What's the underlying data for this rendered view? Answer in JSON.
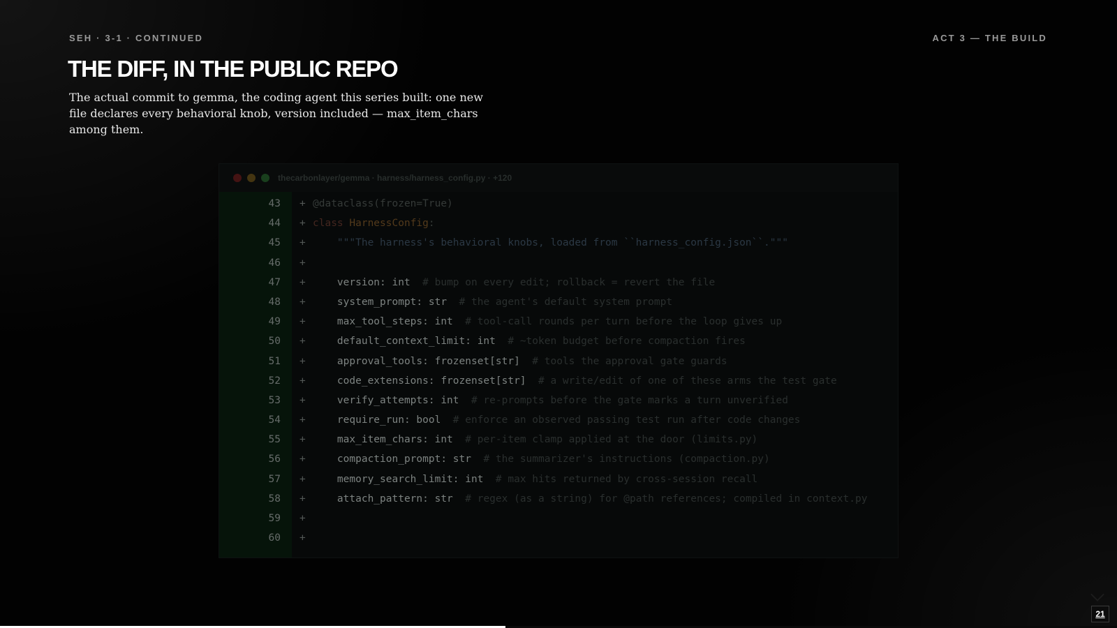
{
  "header": {
    "section_label": "SEH · 3-1 · CONTINUED",
    "act_label": "ACT 3 — THE BUILD"
  },
  "slide": {
    "title": "THE DIFF, IN THE PUBLIC REPO",
    "subtitle": "The actual commit to gemma, the coding agent this series built: one new file declares every behavioral knob, version included — max_item_chars among them."
  },
  "code_window": {
    "title": "thecarbonlayer/gemma · harness/harness_config.py · +120",
    "controls": [
      "close",
      "minimize",
      "maximize"
    ],
    "lines": [
      {
        "n": "43",
        "sign": "+",
        "parts": [
          {
            "c": "deco",
            "t": "@dataclass(frozen=True)"
          }
        ]
      },
      {
        "n": "44",
        "sign": "+",
        "parts": [
          {
            "c": "kw",
            "t": "class "
          },
          {
            "c": "cls",
            "t": "HarnessConfig"
          },
          {
            "c": "deco",
            "t": ":"
          }
        ]
      },
      {
        "n": "45",
        "sign": "+",
        "parts": [
          {
            "c": "doc",
            "t": "    \"\"\"The harness's behavioral knobs, loaded from ``harness_config.json``.\"\"\""
          }
        ]
      },
      {
        "n": "46",
        "sign": "+",
        "parts": []
      },
      {
        "n": "47",
        "sign": "+",
        "parts": [
          {
            "c": "field",
            "t": "    version: int"
          },
          {
            "c": "cmt",
            "t": "  # bump on every edit; rollback = revert the file"
          }
        ]
      },
      {
        "n": "48",
        "sign": "+",
        "parts": [
          {
            "c": "field",
            "t": "    system_prompt: str"
          },
          {
            "c": "cmt",
            "t": "  # the agent's default system prompt"
          }
        ]
      },
      {
        "n": "49",
        "sign": "+",
        "parts": [
          {
            "c": "field",
            "t": "    max_tool_steps: int"
          },
          {
            "c": "cmt",
            "t": "  # tool-call rounds per turn before the loop gives up"
          }
        ]
      },
      {
        "n": "50",
        "sign": "+",
        "parts": [
          {
            "c": "field",
            "t": "    default_context_limit: int"
          },
          {
            "c": "cmt",
            "t": "  # ~token budget before compaction fires"
          }
        ]
      },
      {
        "n": "51",
        "sign": "+",
        "parts": [
          {
            "c": "field",
            "t": "    approval_tools: frozenset[str]"
          },
          {
            "c": "cmt",
            "t": "  # tools the approval gate guards"
          }
        ]
      },
      {
        "n": "52",
        "sign": "+",
        "parts": [
          {
            "c": "field",
            "t": "    code_extensions: frozenset[str]"
          },
          {
            "c": "cmt",
            "t": "  # a write/edit of one of these arms the test gate"
          }
        ]
      },
      {
        "n": "53",
        "sign": "+",
        "parts": [
          {
            "c": "field",
            "t": "    verify_attempts: int"
          },
          {
            "c": "cmt",
            "t": "  # re-prompts before the gate marks a turn unverified"
          }
        ]
      },
      {
        "n": "54",
        "sign": "+",
        "parts": [
          {
            "c": "field",
            "t": "    require_run: bool"
          },
          {
            "c": "cmt",
            "t": "  # enforce an observed passing test run after code changes"
          }
        ]
      },
      {
        "n": "55",
        "sign": "+",
        "parts": [
          {
            "c": "field",
            "t": "    max_item_chars: int"
          },
          {
            "c": "cmt",
            "t": "  # per-item clamp applied at the door (limits.py)"
          }
        ]
      },
      {
        "n": "56",
        "sign": "+",
        "parts": [
          {
            "c": "field",
            "t": "    compaction_prompt: str"
          },
          {
            "c": "cmt",
            "t": "  # the summarizer's instructions (compaction.py)"
          }
        ]
      },
      {
        "n": "57",
        "sign": "+",
        "parts": [
          {
            "c": "field",
            "t": "    memory_search_limit: int"
          },
          {
            "c": "cmt",
            "t": "  # max hits returned by cross-session recall"
          }
        ]
      },
      {
        "n": "58",
        "sign": "+",
        "parts": [
          {
            "c": "field",
            "t": "    attach_pattern: str"
          },
          {
            "c": "cmt",
            "t": "  # regex (as a string) for @path references; compiled in context.py"
          }
        ]
      },
      {
        "n": "59",
        "sign": "+",
        "parts": []
      },
      {
        "n": "60",
        "sign": "+",
        "parts": []
      }
    ]
  },
  "footer": {
    "page_number": "21",
    "progress": 0.4525
  }
}
